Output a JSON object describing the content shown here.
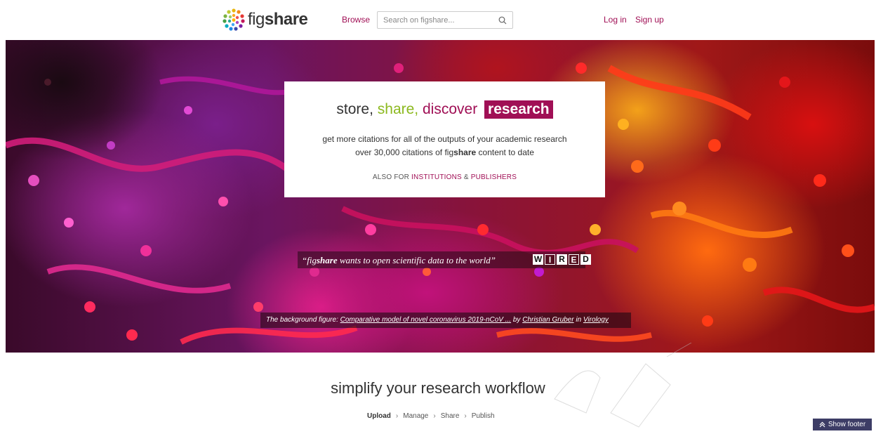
{
  "header": {
    "logo": {
      "prefix": "fig",
      "bold": "share"
    },
    "browse_label": "Browse",
    "search": {
      "placeholder": "Search on figshare...",
      "value": ""
    },
    "login_label": "Log in",
    "signup_label": "Sign up"
  },
  "hero": {
    "tagline": {
      "store": "store,",
      "share": "share,",
      "discover": "discover",
      "research": "research"
    },
    "subtitle_line1": "get more citations for all of the outputs of your academic research",
    "subtitle_line2_prefix": "over 30,000 citations of fig",
    "subtitle_line2_bold": "share",
    "subtitle_line2_suffix": " content to date",
    "also_prefix": "ALSO FOR",
    "institutions_link": "INSTITUTIONS",
    "amp": "&",
    "publishers_link": "PUBLISHERS",
    "quote": {
      "open": "“fig",
      "bold": "share",
      "rest": " wants to open scientific data to the world”",
      "wired_letters": [
        "W",
        "I",
        "R",
        "E",
        "D"
      ]
    },
    "credit": {
      "prefix": "The background figure: ",
      "title_link": "Comparative model of novel coronavirus 2019-nCoV ...",
      "by": " by ",
      "author_link": "Christian Gruber",
      "in": " in ",
      "journal_link": "Virology"
    }
  },
  "workflow": {
    "title": "simplify your research workflow",
    "steps": [
      "Upload",
      "Manage",
      "Share",
      "Publish"
    ],
    "separator": "›"
  },
  "footer_toggle": {
    "label": "Show footer",
    "icon": "double-chevron-up-icon"
  },
  "colors": {
    "brand": "#a00f55",
    "green": "#8cb91f",
    "footer_button": "#3d3d66"
  }
}
